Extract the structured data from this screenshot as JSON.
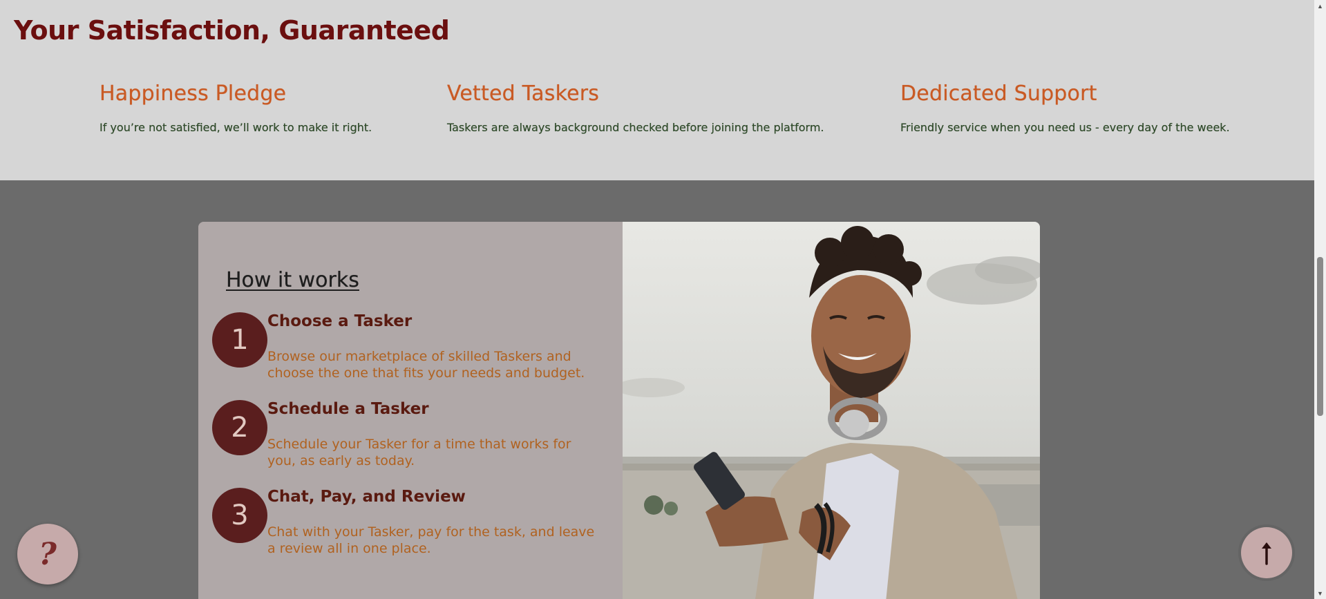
{
  "satisfaction": {
    "title": "Your Satisfaction, Guaranteed",
    "features": [
      {
        "title": "Happiness Pledge",
        "desc": "If you’re not satisfied, we’ll work to make it right."
      },
      {
        "title": "Vetted Taskers",
        "desc": "Taskers are always background checked before joining the platform."
      },
      {
        "title": "Dedicated Support",
        "desc": "Friendly service when you need us - every day of the week."
      }
    ]
  },
  "how_it_works": {
    "title": "How it works",
    "steps": [
      {
        "num": "1",
        "title": "Choose a Tasker",
        "desc": "Browse our marketplace of skilled Taskers and choose the one that fits your needs and budget."
      },
      {
        "num": "2",
        "title": "Schedule a Tasker",
        "desc": "Schedule your Tasker for a time that works for you, as early as today."
      },
      {
        "num": "3",
        "title": "Chat, Pay, and Review",
        "desc": "Chat with your Tasker, pay for the task, and leave a review all in one place."
      }
    ]
  },
  "floating": {
    "help_label": "?",
    "help_icon": "question-mark-icon",
    "top_icon": "arrow-up-icon"
  },
  "colors": {
    "accent": "#6b0f0f",
    "feature_title": "#c95a24",
    "step_badge": "#5a1e1e",
    "step_desc": "#b06220",
    "button_bg": "#c6aaaa"
  }
}
